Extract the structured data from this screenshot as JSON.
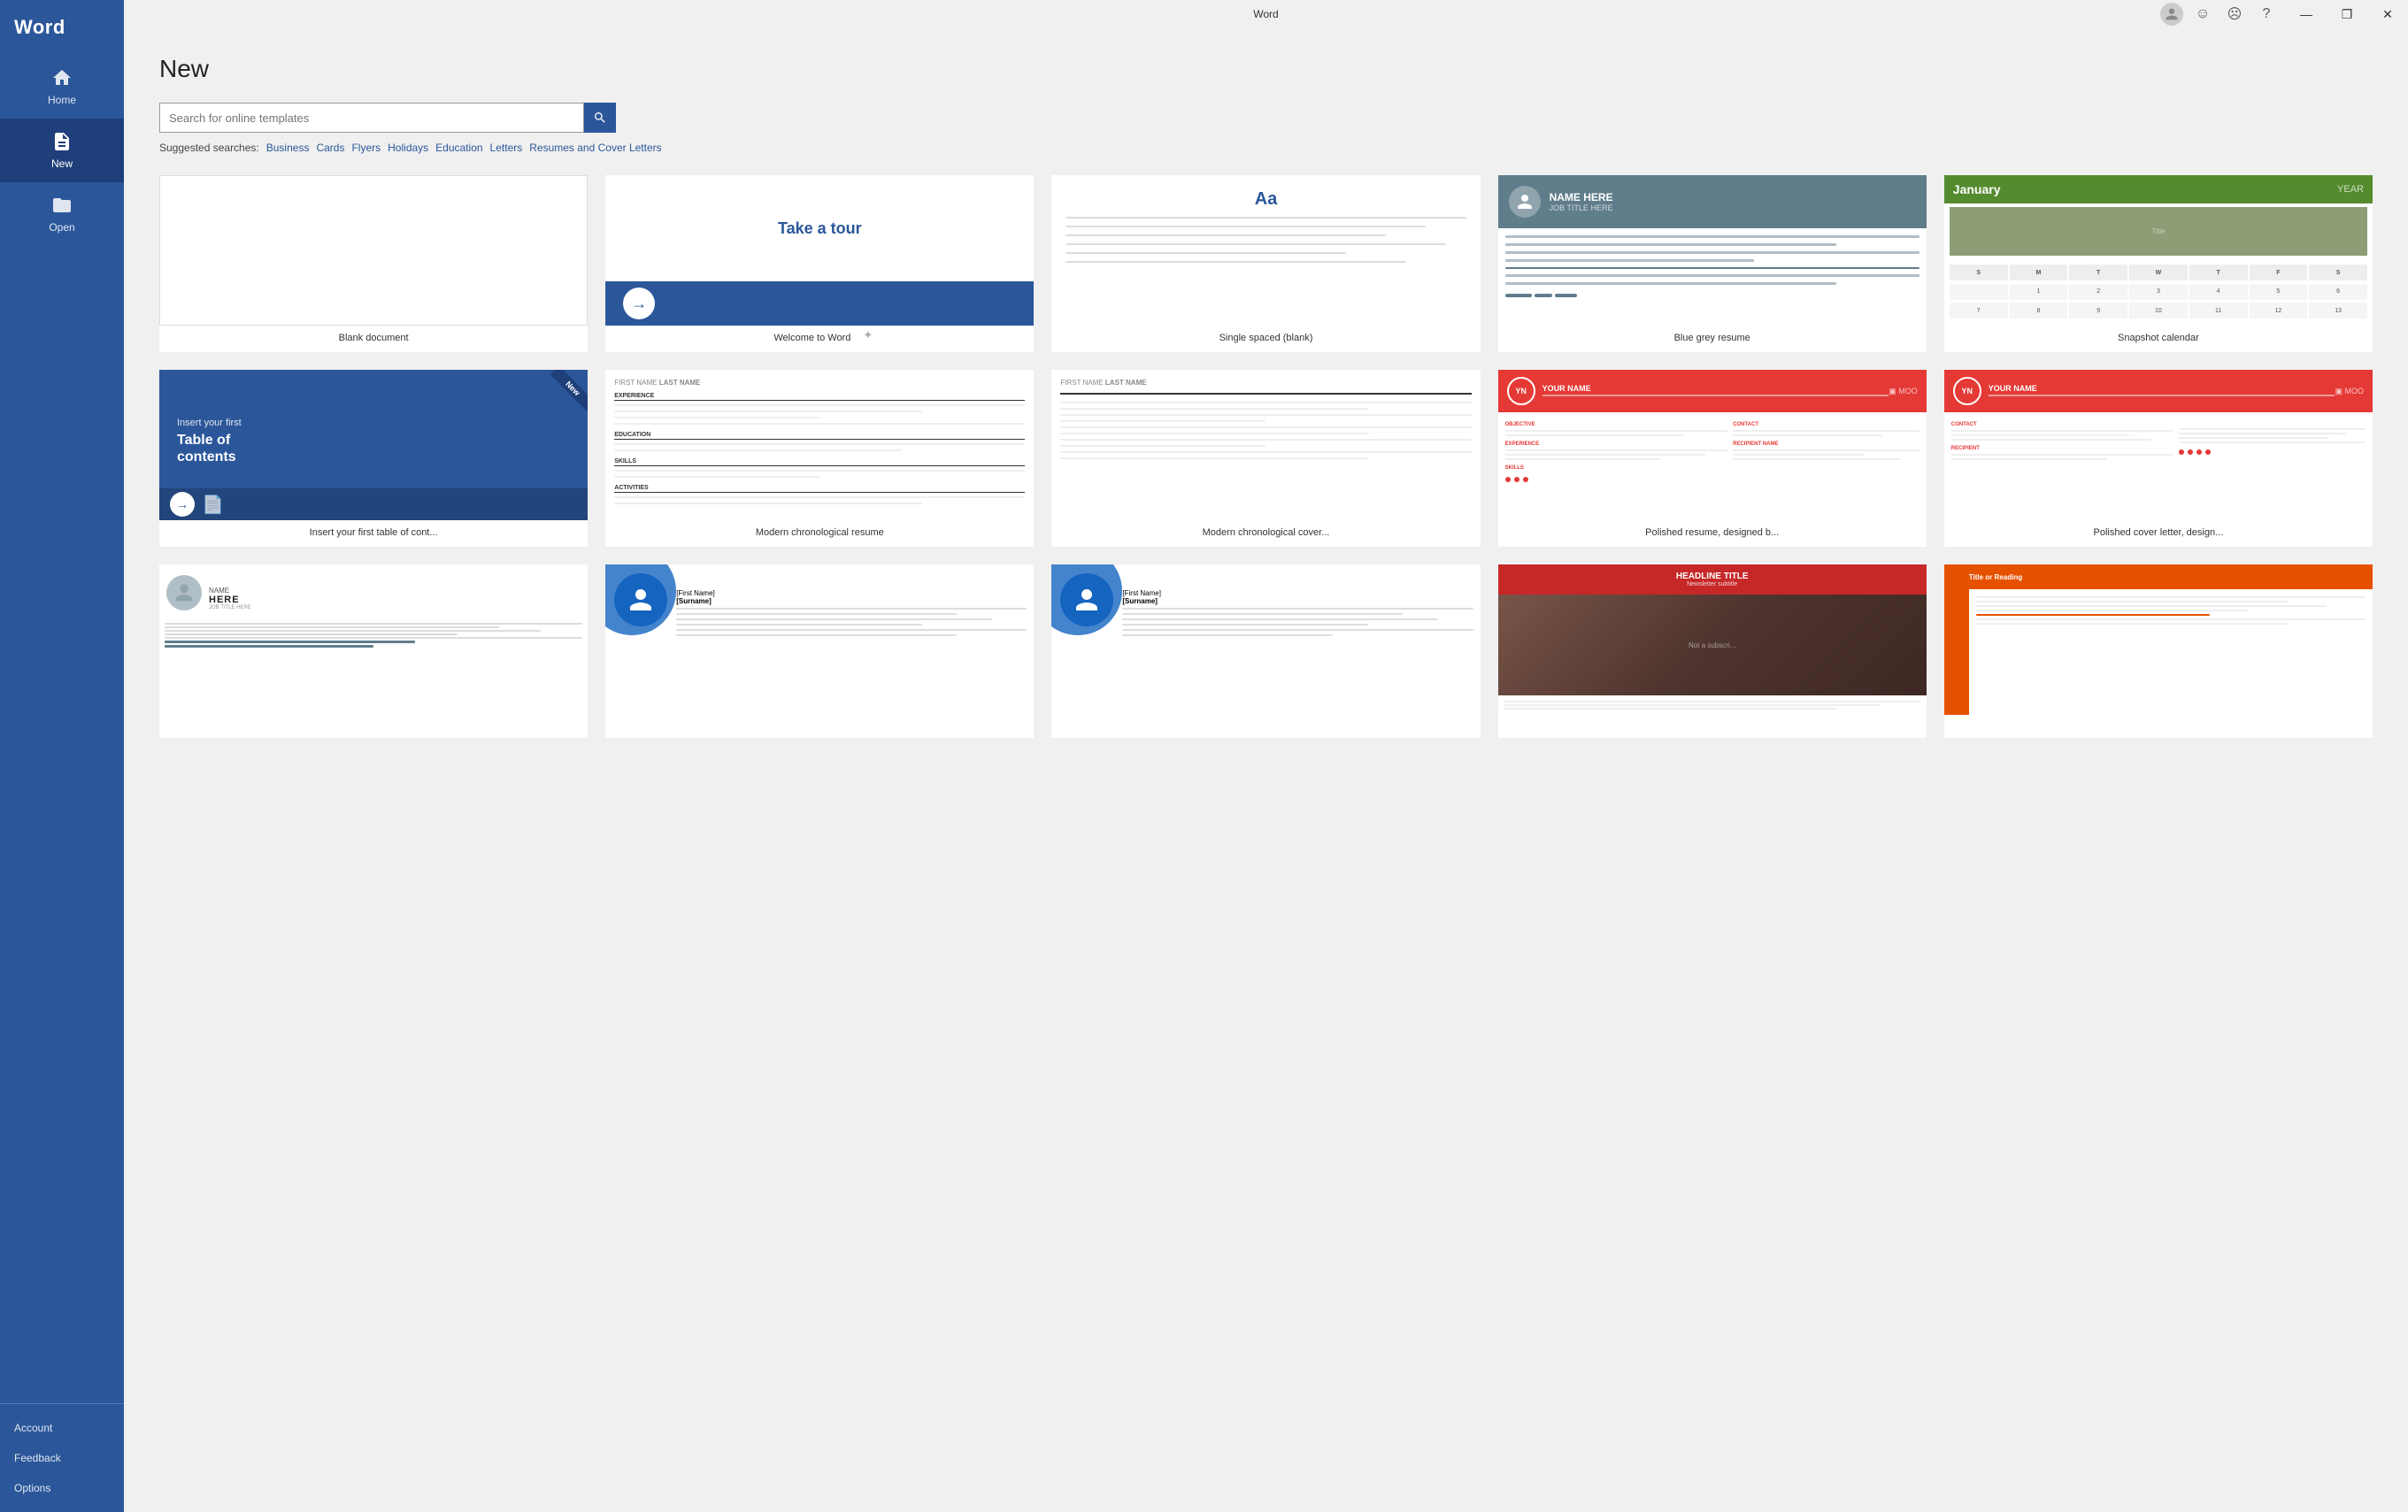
{
  "app": {
    "title": "Word",
    "window_title": "Word"
  },
  "titlebar": {
    "title": "Word",
    "minimize": "—",
    "maximize": "❐",
    "close": "✕"
  },
  "sidebar": {
    "title": "Word",
    "items": [
      {
        "id": "home",
        "label": "Home",
        "icon": "home-icon"
      },
      {
        "id": "new",
        "label": "New",
        "icon": "new-icon",
        "active": true
      },
      {
        "id": "open",
        "label": "Open",
        "icon": "open-icon"
      }
    ],
    "bottom_items": [
      {
        "id": "account",
        "label": "Account"
      },
      {
        "id": "feedback",
        "label": "Feedback"
      },
      {
        "id": "options",
        "label": "Options"
      }
    ]
  },
  "main": {
    "page_title": "New",
    "search": {
      "placeholder": "Search for online templates",
      "button_label": "🔍"
    },
    "suggested": {
      "label": "Suggested searches:",
      "items": [
        "Business",
        "Cards",
        "Flyers",
        "Holidays",
        "Education",
        "Letters",
        "Resumes and Cover Letters"
      ]
    },
    "templates": [
      {
        "id": "blank",
        "label": "Blank document",
        "type": "blank"
      },
      {
        "id": "tour",
        "label": "Welcome to Word",
        "type": "tour",
        "has_pin": true
      },
      {
        "id": "single-spaced",
        "label": "Single spaced (blank)",
        "type": "single-spaced"
      },
      {
        "id": "blue-grey-resume",
        "label": "Blue grey resume",
        "type": "blue-grey-resume"
      },
      {
        "id": "snapshot-calendar",
        "label": "Snapshot calendar",
        "type": "snapshot-calendar"
      },
      {
        "id": "toc",
        "label": "Insert your first table of cont...",
        "type": "toc",
        "is_new": true
      },
      {
        "id": "modern-chrono-resume",
        "label": "Modern chronological resume",
        "type": "modern-chrono-resume"
      },
      {
        "id": "modern-chrono-cover",
        "label": "Modern chronological cover...",
        "type": "modern-chrono-cover"
      },
      {
        "id": "polished-resume",
        "label": "Polished resume, designed b...",
        "type": "polished-resume"
      },
      {
        "id": "polished-cover",
        "label": "Polished cover letter, design...",
        "type": "polished-cover"
      },
      {
        "id": "photo-resume-1",
        "label": "",
        "type": "photo-resume"
      },
      {
        "id": "blue-circle-1",
        "label": "",
        "type": "blue-circle"
      },
      {
        "id": "blue-circle-2",
        "label": "",
        "type": "blue-circle"
      },
      {
        "id": "newsletter",
        "label": "",
        "type": "newsletter"
      },
      {
        "id": "orange",
        "label": "",
        "type": "orange"
      }
    ]
  }
}
